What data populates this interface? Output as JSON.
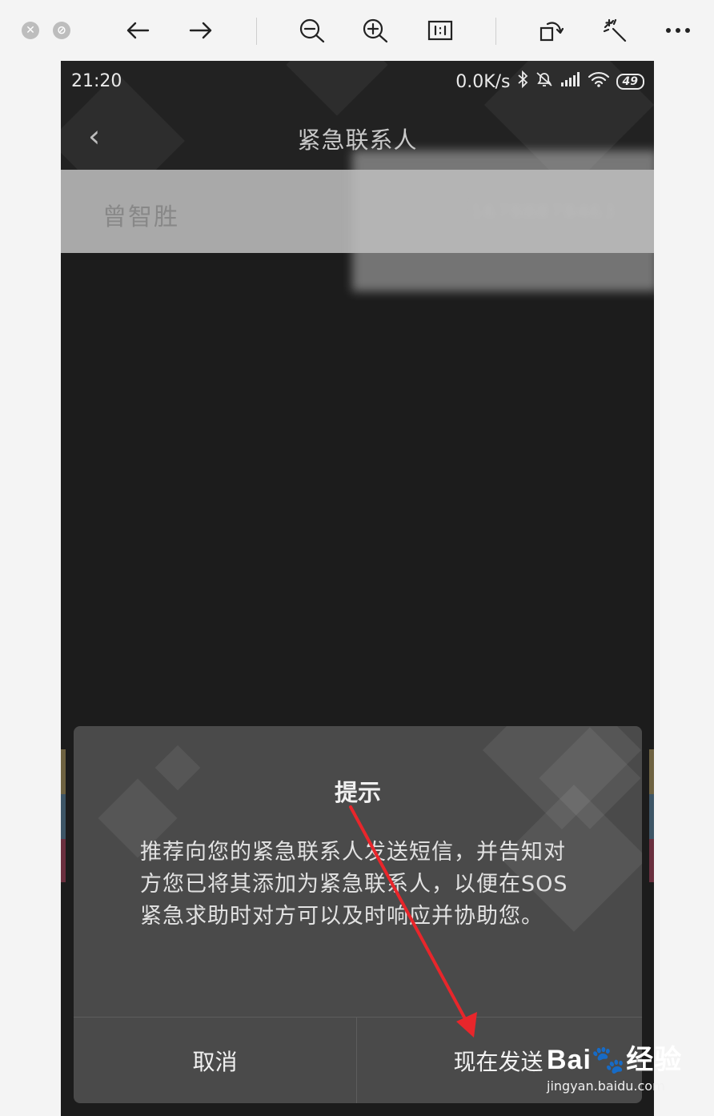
{
  "viewer_toolbar": {
    "close_icon": "close-circle-icon",
    "minimize_icon": "minimize-circle-icon",
    "back_icon": "arrow-left-icon",
    "forward_icon": "arrow-right-icon",
    "zoom_out_icon": "zoom-out-icon",
    "zoom_in_icon": "zoom-in-icon",
    "actual_size_icon": "actual-size-icon",
    "rotate_icon": "rotate-icon",
    "enhance_icon": "magic-wand-icon",
    "more_icon": "more-icon"
  },
  "status_bar": {
    "time": "21:20",
    "network_speed": "0.0K/s",
    "battery": "49"
  },
  "header": {
    "title": "紧急联系人",
    "back_glyph": "‹"
  },
  "contact": {
    "name": "曾智胜",
    "phone": "16788878463"
  },
  "dialog": {
    "title": "提示",
    "message": "推荐向您的紧急联系人发送短信，并告知对方您已将其添加为紧急联系人，以便在SOS紧急求助时对方可以及时响应并协助您。",
    "cancel_label": "取消",
    "send_label": "现在发送"
  },
  "watermark": {
    "logo": "Bai🐾经验",
    "url": "jingyan.baidu.com"
  },
  "colors": {
    "annotation_arrow": "#e8262b",
    "dialog_bg": "#4a4a4a",
    "screen_bg": "#1c1c1c"
  }
}
